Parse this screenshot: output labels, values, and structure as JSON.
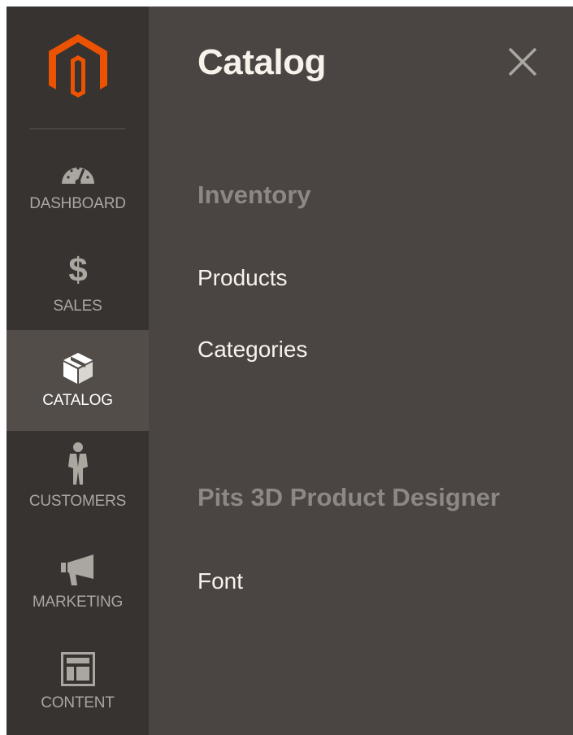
{
  "brand": {
    "logo_icon": "magento-logo-icon",
    "logo_color": "#eb5202"
  },
  "sidebar": {
    "items": [
      {
        "label": "DASHBOARD",
        "icon": "speedometer-icon",
        "active": false
      },
      {
        "label": "SALES",
        "icon": "dollar-icon",
        "active": false
      },
      {
        "label": "CATALOG",
        "icon": "box-icon",
        "active": true
      },
      {
        "label": "CUSTOMERS",
        "icon": "person-icon",
        "active": false
      },
      {
        "label": "MARKETING",
        "icon": "megaphone-icon",
        "active": false
      },
      {
        "label": "CONTENT",
        "icon": "layout-icon",
        "active": false
      }
    ]
  },
  "panel": {
    "title": "Catalog",
    "close_icon": "close-icon",
    "sections": [
      {
        "title": "Inventory",
        "links": [
          "Products",
          "Categories"
        ]
      },
      {
        "title": "Pits 3D Product Designer",
        "links": [
          "Font"
        ]
      }
    ]
  },
  "colors": {
    "sidebar_bg": "#373330",
    "sidebar_active_bg": "#524d49",
    "panel_bg": "#4a4542",
    "section_title": "#8d8883",
    "link_text": "#f7f3eb"
  }
}
